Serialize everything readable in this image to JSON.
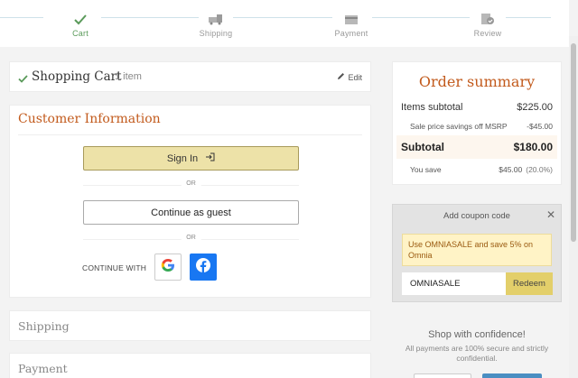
{
  "progress": {
    "steps": [
      {
        "label": "Cart",
        "icon": "check-icon",
        "state": "complete"
      },
      {
        "label": "Shipping",
        "icon": "truck-icon",
        "state": "pending"
      },
      {
        "label": "Payment",
        "icon": "credit-card-icon",
        "state": "pending"
      },
      {
        "label": "Review",
        "icon": "review-icon",
        "state": "pending"
      }
    ]
  },
  "cart": {
    "title": "Shopping Cart",
    "count": "1 item",
    "edit_label": "Edit"
  },
  "customer": {
    "heading": "Customer Information",
    "signin_label": "Sign In",
    "or_label": "OR",
    "guest_label": "Continue as guest",
    "continue_with_label": "CONTINUE WITH"
  },
  "sections": {
    "shipping": "Shipping",
    "payment": "Payment"
  },
  "summary": {
    "title": "Order summary",
    "items_subtotal_label": "Items subtotal",
    "items_subtotal_value": "$225.00",
    "savings_label": "Sale price savings off MSRP",
    "savings_value": "-$45.00",
    "subtotal_label": "Subtotal",
    "subtotal_value": "$180.00",
    "you_save_label": "You save",
    "you_save_value": "$45.00",
    "you_save_pct": "(20.0%)"
  },
  "coupon": {
    "title": "Add coupon code",
    "promo": "Use OMNIASALE and save 5% on Omnia",
    "code_value": "OMNIASALE",
    "redeem_label": "Redeem"
  },
  "confidence": {
    "heading": "Shop with confidence!",
    "text": "All payments are 100% secure and strictly confidential."
  },
  "colors": {
    "accent": "#c25a1c",
    "signin_bg": "#ede2a8",
    "redeem_bg": "#e3cf6a",
    "facebook": "#1877f2",
    "check": "#5a9a5a"
  }
}
